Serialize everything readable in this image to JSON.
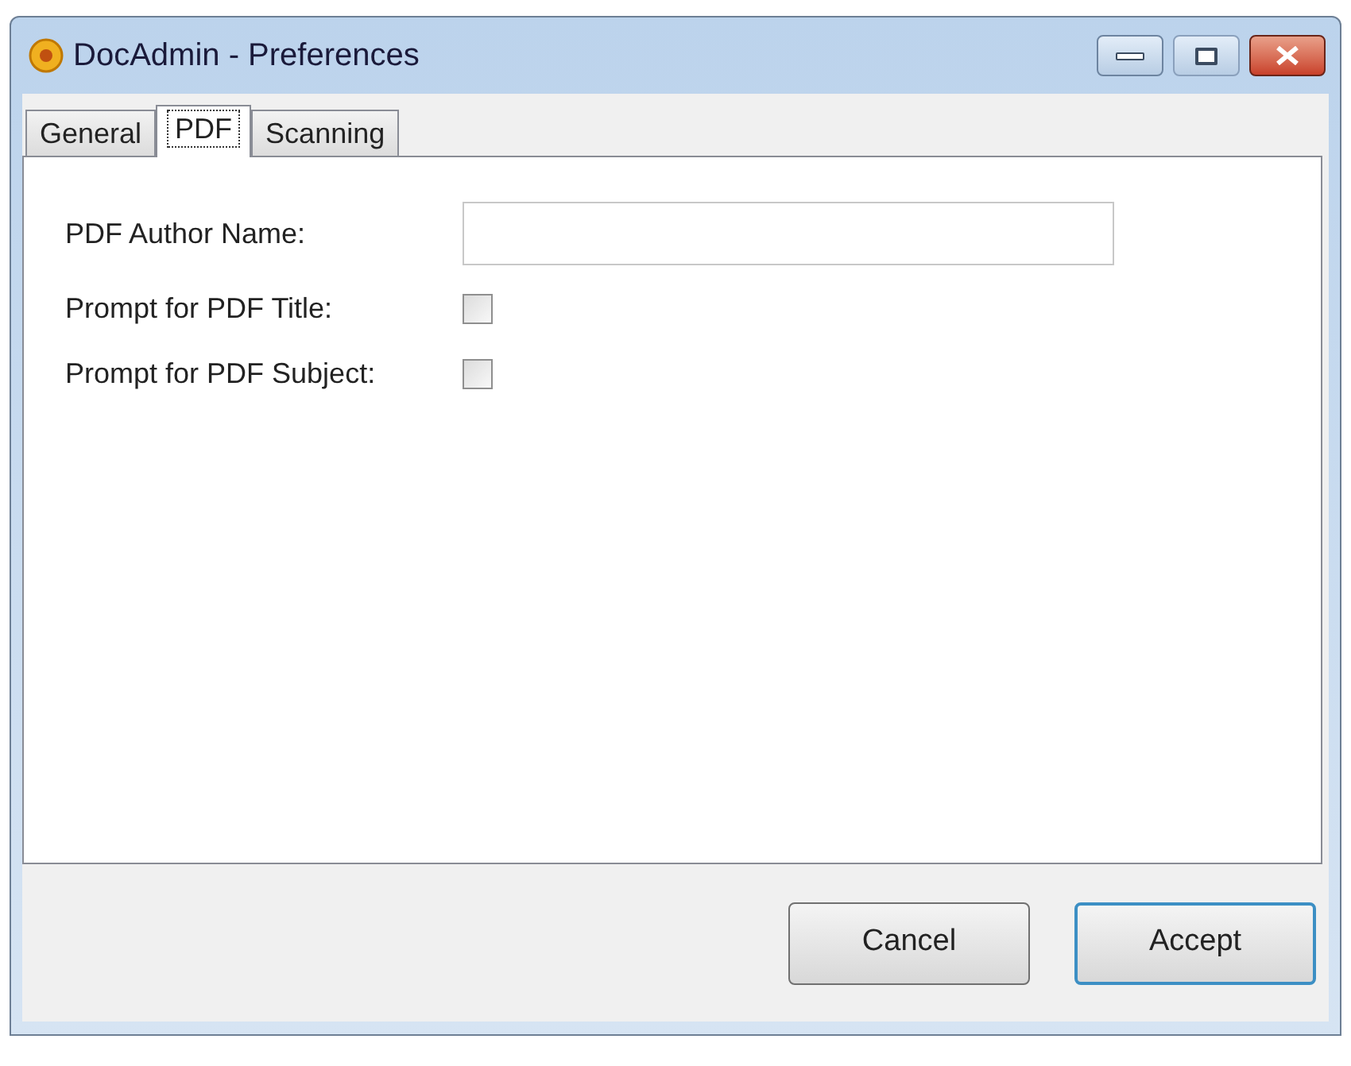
{
  "window": {
    "title": "DocAdmin - Preferences"
  },
  "tabs": [
    {
      "label": "General",
      "selected": false
    },
    {
      "label": "PDF",
      "selected": true
    },
    {
      "label": "Scanning",
      "selected": false
    }
  ],
  "fields": [
    {
      "kind": "text",
      "label": "PDF Author Name:"
    },
    {
      "kind": "checkbox",
      "label": "Prompt for PDF Title:",
      "checked": false
    },
    {
      "kind": "checkbox",
      "label": "Prompt for PDF Subject:",
      "checked": false
    }
  ],
  "buttons": [
    {
      "label": "Cancel",
      "default": false
    },
    {
      "label": "Accept",
      "default": true
    }
  ]
}
